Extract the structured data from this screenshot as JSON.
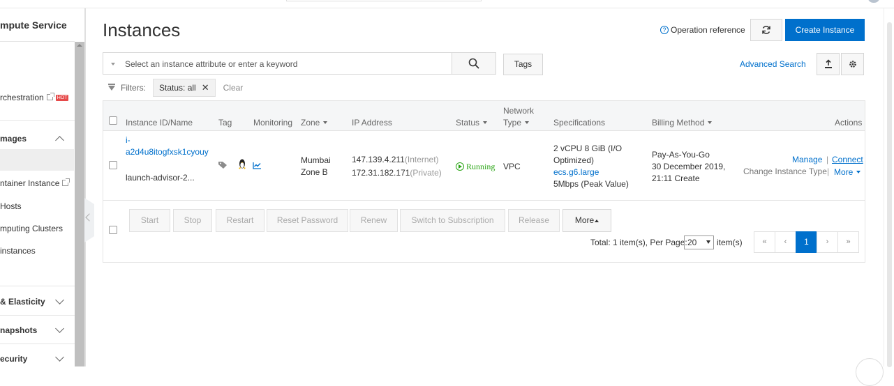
{
  "sidebar": {
    "title": "mpute Service",
    "items": [
      {
        "label": "rchestration",
        "badge": "HOT"
      },
      {
        "label": "mages"
      },
      {
        "label": "ntainer Instance"
      },
      {
        "label": " Hosts"
      },
      {
        "label": "mputing Clusters"
      },
      {
        "label": "instances"
      },
      {
        "label": "& Elasticity"
      },
      {
        "label": "napshots"
      },
      {
        "label": "ecurity"
      }
    ]
  },
  "header": {
    "title": "Instances",
    "operation_reference": "Operation reference",
    "create_instance": "Create Instance"
  },
  "search": {
    "placeholder": "Select an instance attribute or enter a keyword",
    "tags_button": "Tags",
    "advanced_search": "Advanced Search"
  },
  "filters": {
    "label": "Filters:",
    "chip": "Status: all",
    "chip_close": "✕",
    "clear": "Clear"
  },
  "table": {
    "columns": {
      "instance": "Instance ID/Name",
      "tag": "Tag",
      "monitoring": "Monitoring",
      "zone": "Zone",
      "ip": "IP Address",
      "status": "Status",
      "network_line1": "Network",
      "network_line2": "Type",
      "specifications": "Specifications",
      "billing": "Billing Method",
      "actions": "Actions"
    },
    "rows": [
      {
        "id_line1": "i-",
        "id_line2": "a2d4u8itogfxsk1cyouy",
        "name": "launch-advisor-2...",
        "zone_line1": "Mumbai",
        "zone_line2": "Zone B",
        "ip_public": "147.139.4.211",
        "ip_public_label": "(Internet)",
        "ip_private": "172.31.182.171",
        "ip_private_label": "(Private)",
        "status": "Running",
        "network_type": "VPC",
        "spec_line1": "2 vCPU 8 GiB (I/O",
        "spec_line2": "Optimized)",
        "spec_type": "ecs.g6.large",
        "spec_bandwidth": "5Mbps (Peak Value)",
        "billing_line1": "Pay-As-You-Go",
        "billing_line2": "30 December 2019,",
        "billing_line3": "21:11 Create",
        "action_manage": "Manage",
        "action_sep": "|",
        "action_connect": "Connect",
        "action_change_type": "Change Instance Type",
        "action_more": "More"
      }
    ]
  },
  "bulk_actions": {
    "start": "Start",
    "stop": "Stop",
    "restart": "Restart",
    "reset_password": "Reset Password",
    "renew": "Renew",
    "switch_subscription": "Switch to Subscription",
    "release": "Release",
    "more": "More"
  },
  "pagination": {
    "total_text": "Total: 1 item(s), Per Page:",
    "per_page": "20",
    "items_suffix": "item(s)",
    "first": "«",
    "prev": "‹",
    "current": "1",
    "next": "›",
    "last": "»"
  },
  "colors": {
    "accent": "#0070cc",
    "running": "#2aa515",
    "hot_badge": "#e64a4a"
  },
  "icons": [
    "external-link-icon",
    "chevron-up-icon",
    "chevron-down-icon",
    "help-icon",
    "refresh-icon",
    "search-icon",
    "export-icon",
    "settings-icon",
    "filter-icon",
    "tag-icon",
    "linux-icon",
    "monitoring-icon",
    "running-icon"
  ]
}
